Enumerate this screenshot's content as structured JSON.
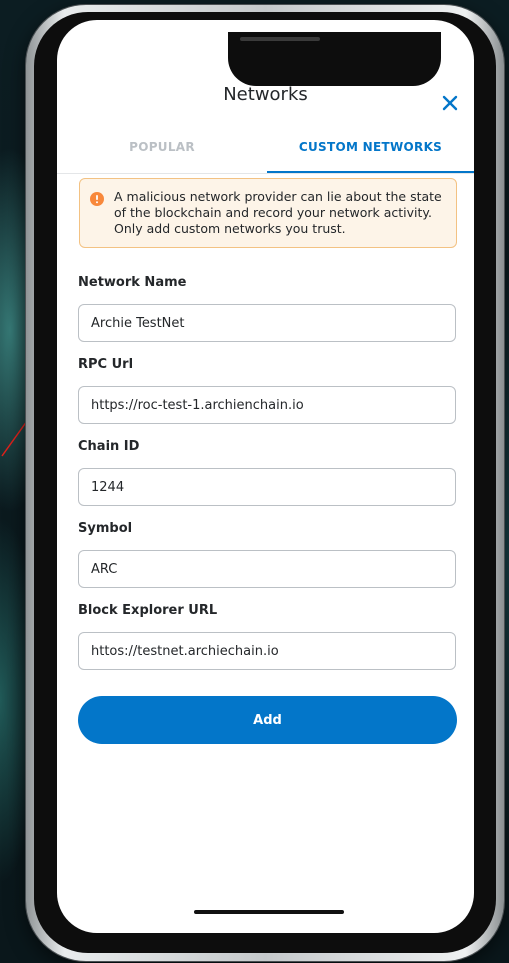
{
  "header": {
    "title": "Networks",
    "close_icon": "close-icon",
    "close_color": "#0376c9"
  },
  "tabs": [
    {
      "label": "POPULAR",
      "active": false
    },
    {
      "label": "CUSTOM NETWORKS",
      "active": true
    }
  ],
  "warning": {
    "icon": "exclamation-circle-icon",
    "text": "A malicious network provider can lie about the state of the blockchain and record your network activity. Only add custom networks you trust.",
    "background": "#fdf4e8",
    "border_color": "#f3c283",
    "icon_color": "#f8883b"
  },
  "form": {
    "network_name": {
      "label": "Network Name",
      "value": "Archie TestNet"
    },
    "rpc_url": {
      "label": "RPC Url",
      "value": "https://roc-test-1.archienchain.io"
    },
    "chain_id": {
      "label": "Chain ID",
      "value": "1244"
    },
    "symbol": {
      "label": "Symbol",
      "value": "ARC"
    },
    "block_explorer_url": {
      "label": "Block Explorer URL",
      "value": "httos://testnet.archiechain.io"
    }
  },
  "add_button": {
    "label": "Add"
  },
  "colors": {
    "accent": "#0376c9",
    "annotation_arrow": "#e0211b"
  }
}
